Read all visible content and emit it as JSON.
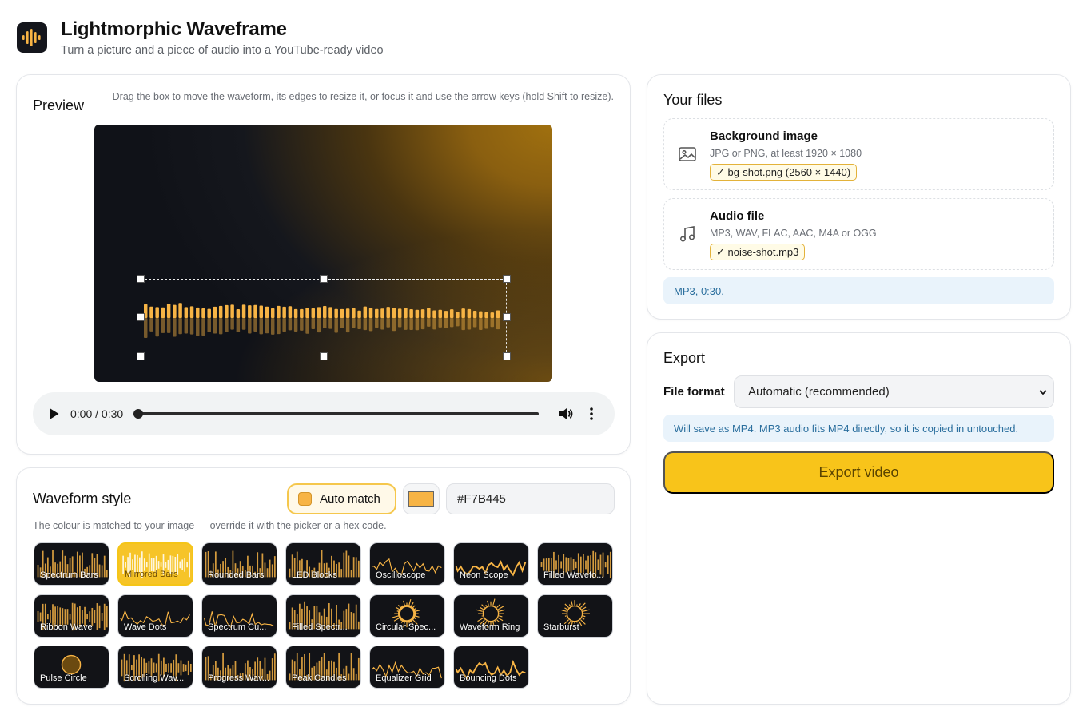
{
  "app": {
    "title": "Lightmorphic Waveframe",
    "subtitle": "Turn a picture and a piece of audio into a YouTube-ready video",
    "logo_icon": "waveform-logo-icon"
  },
  "preview": {
    "title": "Preview",
    "hint": "Drag the box to move the waveform, its edges to resize it, or focus it and use the arrow keys (hold Shift to resize).",
    "player": {
      "time": "0:00 / 0:30",
      "progress": 0
    }
  },
  "style": {
    "title": "Waveform style",
    "auto_match_label": "Auto match",
    "color": "#F7B445",
    "hex_value": "#F7B445",
    "note": "The colour is matched to your image — override it with the picker or a hex code.",
    "selected": "Mirrored Bars",
    "tiles": [
      {
        "label": "Spectrum Bars"
      },
      {
        "label": "Mirrored Bars"
      },
      {
        "label": "Rounded Bars"
      },
      {
        "label": "LED Blocks"
      },
      {
        "label": "Oscilloscope"
      },
      {
        "label": "Neon Scope"
      },
      {
        "label": "Filled Wavefo..."
      },
      {
        "label": "Ribbon Wave"
      },
      {
        "label": "Wave Dots"
      },
      {
        "label": "Spectrum Cu..."
      },
      {
        "label": "Filled Spectr..."
      },
      {
        "label": "Circular Spec..."
      },
      {
        "label": "Waveform Ring"
      },
      {
        "label": "Starburst"
      },
      {
        "label": "Pulse Circle"
      },
      {
        "label": "Scrolling Wav..."
      },
      {
        "label": "Progress Wav..."
      },
      {
        "label": "Peak Candles"
      },
      {
        "label": "Equalizer Grid"
      },
      {
        "label": "Bouncing Dots"
      }
    ]
  },
  "files": {
    "title": "Your files",
    "background": {
      "name": "Background image",
      "hint": "JPG or PNG, at least 1920 × 1080",
      "chip": "✓ bg-shot.png (2560 × 1440)"
    },
    "audio": {
      "name": "Audio file",
      "hint": "MP3, WAV, FLAC, AAC, M4A or OGG",
      "chip": "✓ noise-shot.mp3"
    },
    "info": "MP3, 0:30."
  },
  "export": {
    "title": "Export",
    "format_label": "File format",
    "format_value": "Automatic (recommended)",
    "info": "Will save as MP4. MP3 audio fits MP4 directly, so it is copied in untouched.",
    "button_label": "Export video"
  },
  "colors": {
    "accent": "#F8C41A",
    "waveform": "#F7B445",
    "info_bg": "#E9F3FB",
    "info_text": "#2B6F9E"
  }
}
